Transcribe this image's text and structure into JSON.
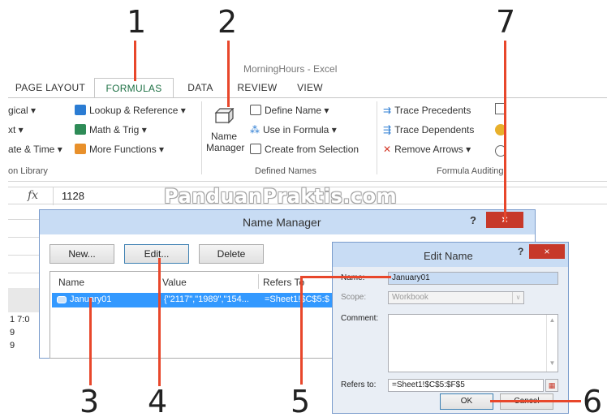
{
  "callouts": [
    "1",
    "2",
    "3",
    "4",
    "5",
    "6",
    "7"
  ],
  "window": {
    "title": "MorningHours - Excel"
  },
  "ribbon_tabs": [
    {
      "label": "PAGE LAYOUT"
    },
    {
      "label": "FORMULAS",
      "active": true
    },
    {
      "label": "DATA"
    },
    {
      "label": "REVIEW"
    },
    {
      "label": "VIEW"
    }
  ],
  "ribbon": {
    "function_library": {
      "left_items": [
        "gical ▾",
        "xt ▾",
        "ate & Time ▾"
      ],
      "items": [
        "Lookup & Reference ▾",
        "Math & Trig ▾",
        "More Functions ▾"
      ],
      "group_label": "on Library"
    },
    "defined_names": {
      "name_manager_line1": "Name",
      "name_manager_line2": "Manager",
      "items": [
        "Define Name  ▾",
        "Use in Formula ▾",
        "Create from Selection"
      ],
      "group_label": "Defined Names"
    },
    "formula_auditing": {
      "items": [
        "Trace Precedents",
        "Trace Dependents",
        "Remove Arrows  ▾"
      ],
      "group_label": "Formula Auditing"
    }
  },
  "formula_bar": {
    "fx": "fx",
    "value": "1128"
  },
  "grid": {
    "row_text": "1    7:0",
    "row_a": "9",
    "row_b": "9"
  },
  "watermark": "PanduanPraktis.com",
  "name_manager": {
    "title": "Name Manager",
    "help": "?",
    "close": "×",
    "buttons": {
      "new": "New...",
      "edit": "Edit...",
      "delete": "Delete"
    },
    "columns": [
      "Name",
      "Value",
      "Refers To"
    ],
    "row": {
      "name": "January01",
      "value": "{\"2117\",\"1989\",\"154...",
      "refers_to": "=Sheet1!$C$5:$"
    }
  },
  "edit_name": {
    "title": "Edit Name",
    "help": "?",
    "close": "×",
    "labels": {
      "name": "Name:",
      "scope": "Scope:",
      "comment": "Comment:",
      "refers_to": "Refers to:"
    },
    "name_value": "January01",
    "scope_value": "Workbook",
    "refers_to_value": "=Sheet1!$C$5:$F$5",
    "ok": "OK",
    "cancel": "Cancel"
  },
  "colors": {
    "accent": "#e8472b",
    "excel_green": "#1e7145",
    "selection": "#3399ff",
    "close_red": "#c7392a"
  }
}
